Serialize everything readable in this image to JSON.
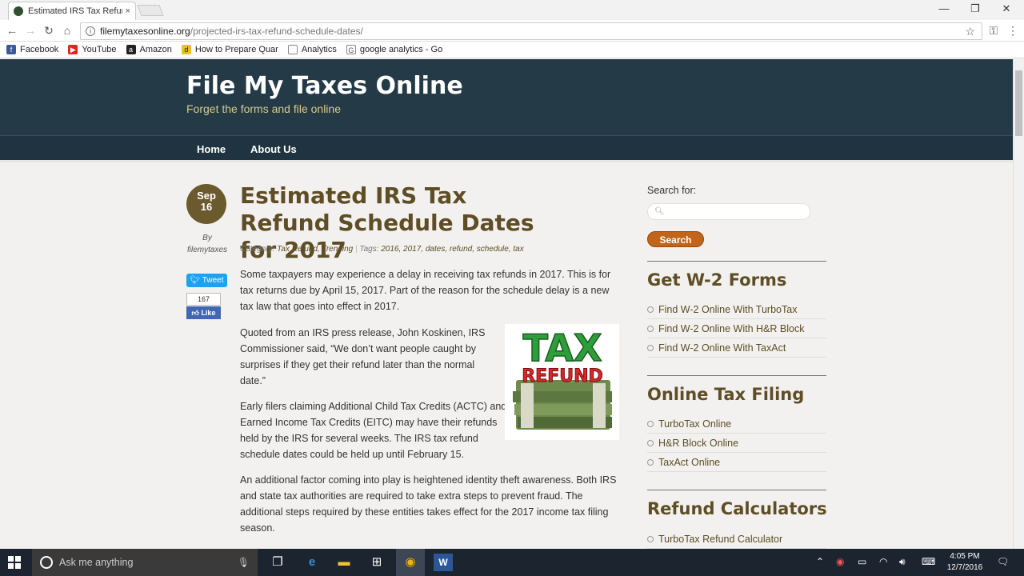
{
  "browser": {
    "tab_title": "Estimated IRS Tax Refund",
    "tab_close": "×",
    "url_host": "filemytaxesonline.org",
    "url_path": "/projected-irs-tax-refund-schedule-dates/",
    "window_min": "—",
    "window_max": "❐",
    "window_close": "✕"
  },
  "bookmarks": [
    {
      "label": "Facebook",
      "icon": "facebook-icon",
      "color": "#3b5998",
      "glyph": "f"
    },
    {
      "label": "YouTube",
      "icon": "youtube-icon",
      "color": "#e62117",
      "glyph": "▶"
    },
    {
      "label": "Amazon",
      "icon": "amazon-icon",
      "color": "#222222",
      "glyph": "a"
    },
    {
      "label": "How to Prepare Quar",
      "icon": "d-icon",
      "color": "#e8c21a",
      "glyph": "d"
    },
    {
      "label": "Analytics",
      "icon": "page-icon",
      "color": "#ffffff",
      "glyph": ""
    },
    {
      "label": "google analytics - Go",
      "icon": "google-icon",
      "color": "#ffffff",
      "glyph": "G"
    }
  ],
  "site": {
    "title": "File My Taxes Online",
    "tagline": "Forget the forms and file online",
    "nav": [
      "Home",
      "About Us"
    ]
  },
  "post": {
    "month": "Sep",
    "day": "16",
    "by": "By",
    "author": "filemytaxes",
    "tweet": "Tweet",
    "like_count": "167",
    "like": "Like",
    "title": "Estimated IRS Tax Refund Schedule Dates for 2017",
    "meta_category_label": "Category:",
    "meta_categories": "Tax Refund, Trending",
    "meta_tags_label": "Tags:",
    "meta_tags": "2016, 2017, dates, refund, schedule, tax",
    "paragraphs": [
      "Some taxpayers may experience a delay in receiving tax refunds in 2017. This is for tax returns due by April 15, 2017. Part of the reason for the schedule delay is a new tax law that goes into effect in 2017.",
      "Quoted from an IRS press release, John Koskinen, IRS Commissioner said, “We don’t want people caught by surprises if they get their refund later than the normal date.”",
      "Early filers claiming Additional Child Tax Credits (ACTC) and Earned Income Tax Credits (EITC) may have their refunds held by the IRS for several weeks. The IRS tax refund schedule dates could be held up until February 15.",
      "An additional factor coming into play is heightened identity theft awareness. Both IRS and state tax authorities are required to take extra steps to prevent fraud. The additional steps required by these entities takes effect for the 2017 income tax filing season."
    ],
    "image_text_top": "TAX",
    "image_text_bottom": "REFUND"
  },
  "sidebar": {
    "search_label": "Search for:",
    "search_button": "Search",
    "widgets": [
      {
        "title": "Get W-2 Forms",
        "items": [
          "Find W-2 Online With TurboTax",
          "Find W-2 Online With H&R Block",
          "Find W-2 Online With TaxAct"
        ]
      },
      {
        "title": "Online Tax Filing",
        "items": [
          "TurboTax Online",
          "H&R Block Online",
          "TaxAct Online"
        ]
      },
      {
        "title": "Refund Calculators",
        "items": [
          "TurboTax Refund Calculator"
        ]
      }
    ]
  },
  "taskbar": {
    "search_placeholder": "Ask me anything",
    "time": "4:05 PM",
    "date": "12/7/2016"
  }
}
